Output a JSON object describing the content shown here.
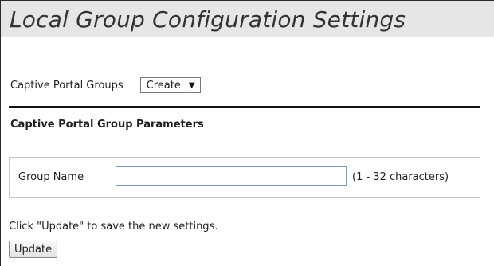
{
  "page": {
    "title": "Local Group Configuration Settings"
  },
  "groups": {
    "label": "Captive Portal Groups",
    "select_value": "Create",
    "arrow_icon": "▼"
  },
  "parameters": {
    "heading": "Captive Portal Group Parameters",
    "group_name_label": "Group Name",
    "group_name_value": "",
    "group_name_hint": "(1 - 32 characters)"
  },
  "footer": {
    "instructions": "Click \"Update\" to save the new settings.",
    "update_label": "Update"
  },
  "colors": {
    "title_bar_bg": "#e6e6e6",
    "separator": "#111111",
    "input_border": "#7a9cc6"
  }
}
